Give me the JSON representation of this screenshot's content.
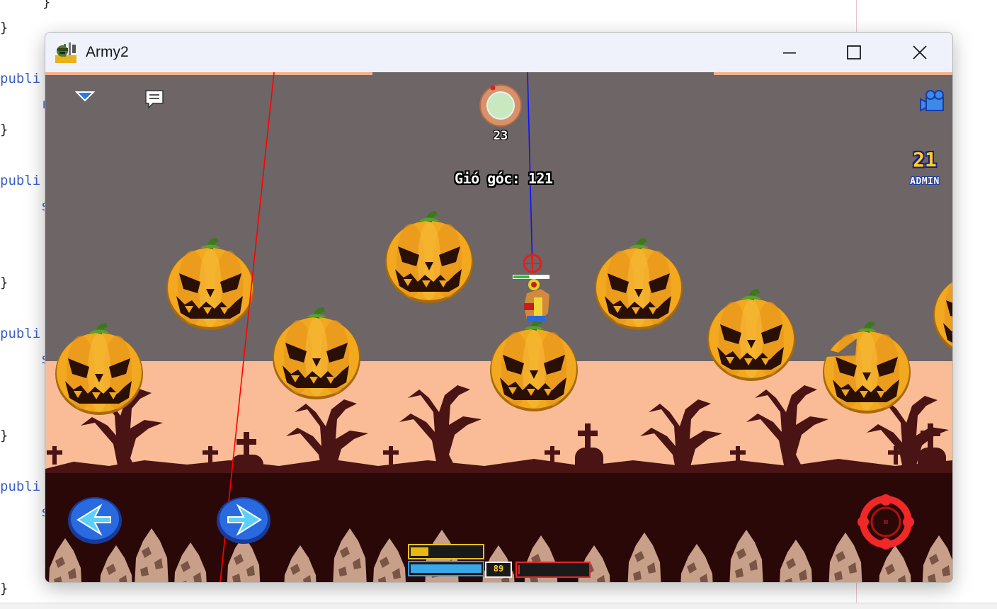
{
  "window": {
    "title": "Army2"
  },
  "background_code": {
    "lines": [
      "}",
      "}",
      "publi",
      "r",
      "}",
      "publi",
      "s",
      "}",
      "publi",
      "s",
      "}",
      "publi",
      "s",
      "}"
    ]
  },
  "hud": {
    "wind_label": "Gió góc: 121",
    "turn_timer": "23",
    "player_number": "21",
    "player_name": "ADMIN",
    "fuel_value": "89",
    "power_fill": 0.25,
    "fuel_fill": 1.0,
    "health_fill": 0.02
  },
  "icons": {
    "menu": "menu-dropdown-icon",
    "chat": "chat-bubble-icon",
    "camera": "camera-icon",
    "move_left": "left-arrow-icon",
    "move_right": "right-arrow-icon",
    "fire": "crosshair-fire-icon"
  },
  "colors": {
    "sky": "#6d6566",
    "horizon": "#f9bc97",
    "ground": "#2a0808",
    "pumpkin": "#f2a81f",
    "aim_line_red": "#ff0000",
    "aim_line_blue": "#1010ff"
  }
}
